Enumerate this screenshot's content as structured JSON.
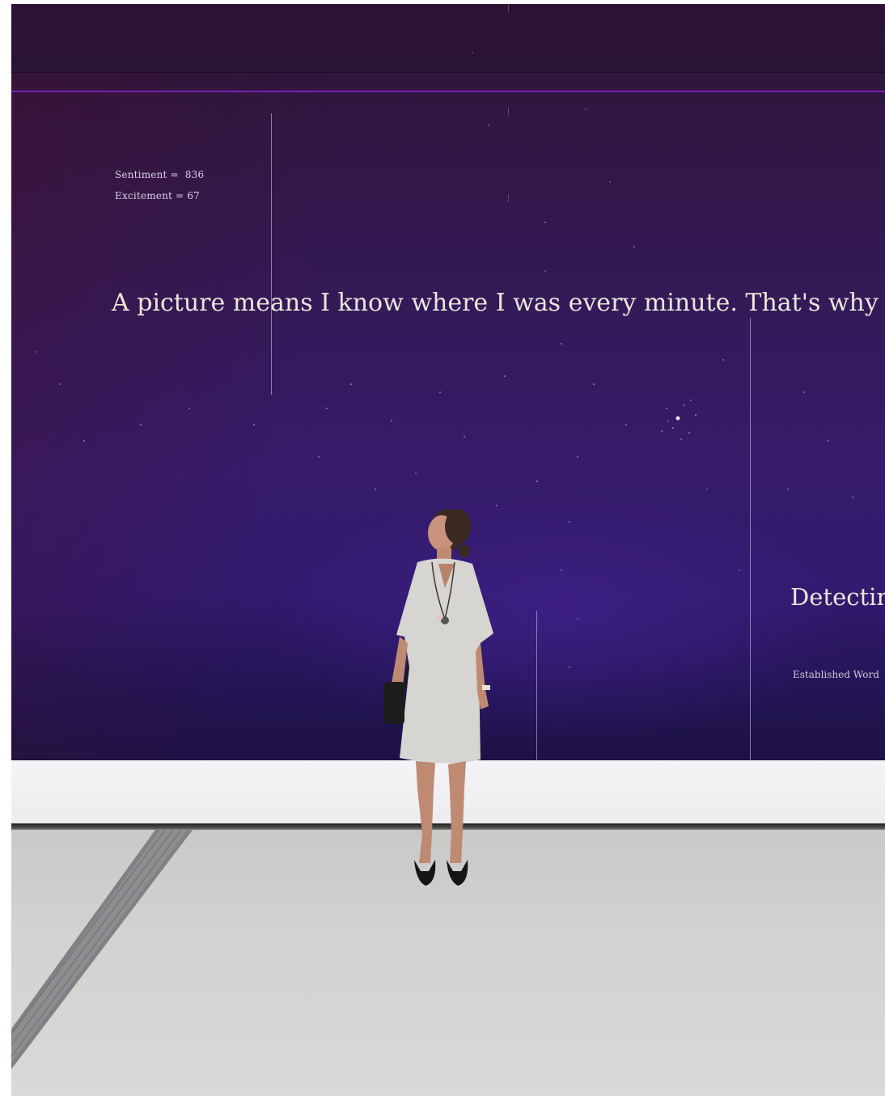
{
  "screen": {
    "metrics": [
      {
        "label": "Sentiment",
        "sep": " =  ",
        "value": "836"
      },
      {
        "label": "Excitement",
        "sep": " = ",
        "value": "67"
      }
    ],
    "headline": "A picture means I know where I was every minute. That's why",
    "side_title": "Detectin",
    "side_subtitle": "Established Word",
    "colors": {
      "accent_line": "#7a1fb8",
      "text": "#ebe6dc"
    }
  },
  "scene": {
    "person": "woman-in-grey-dress-icon",
    "floor": "concrete-floor",
    "floor_vent": "floor-grate-icon"
  }
}
